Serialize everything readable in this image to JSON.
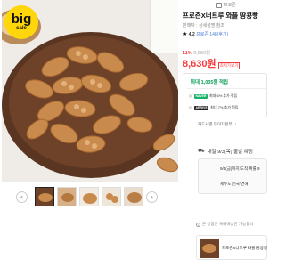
{
  "gallery": {
    "badge": {
      "big": "big",
      "sale": "sale"
    },
    "thumb_arrow_left": "‹",
    "thumb_arrow_right": "›"
  },
  "product": {
    "breadcrumb": "프로즌",
    "title": "프로즌X너트루 와플 땅콩빵",
    "seller": "판매자 : 상세설명 참조",
    "rating_star": "★",
    "rating_value": "4.2",
    "review_count": "프로즌 148(후기)",
    "discount_pct": "11%",
    "original_price": "9,680원",
    "price": "8,630원",
    "lowest_price_badge": "최저가보기"
  },
  "benefits": {
    "points": "최대 1,035원 적립",
    "rows": [
      {
        "tag": "NAVER",
        "text": "최대 6% 추가 적립"
      },
      {
        "tag": "ARRIVE",
        "text": "최대 7% 추가 적립"
      }
    ]
  },
  "card_info": {
    "label": "카드사별 무이자할부",
    "chevron": "›"
  },
  "delivery": {
    "icon": "⛟",
    "label": "내일 9/3(목) 출발 예정",
    "arrival": "9/4(금)까지 도착 확률 9",
    "region": "제주도  전국/연해"
  },
  "notice": {
    "icon": "i",
    "text": "본 상품은 국내배송만 가능합니"
  },
  "option": {
    "name": "프로즌X너트루 와플 땅콩빵"
  }
}
